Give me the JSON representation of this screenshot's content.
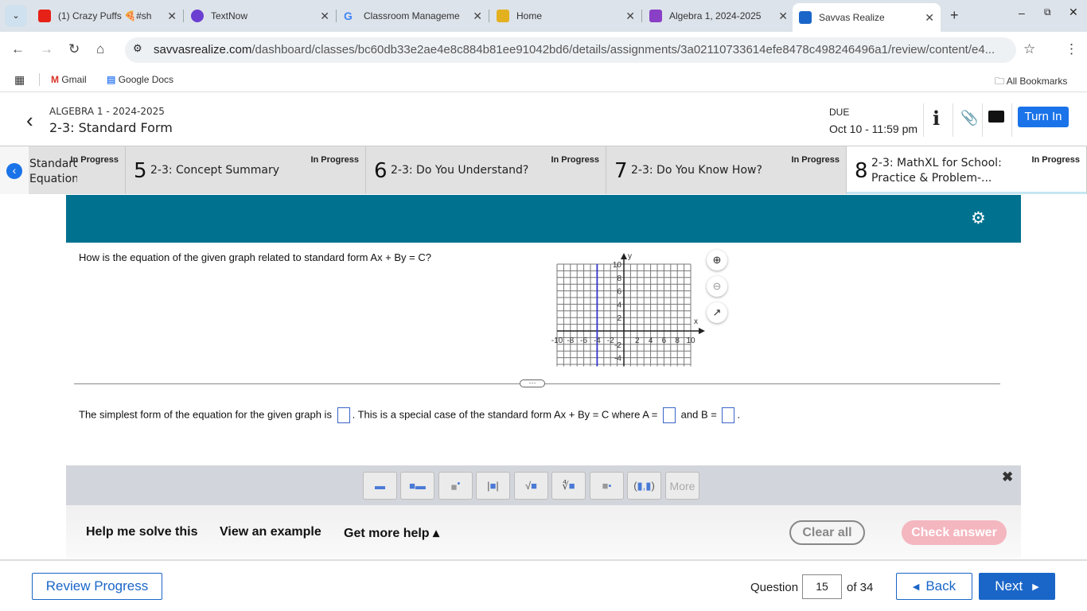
{
  "browser": {
    "tabs": [
      {
        "title": "(1) Crazy Puffs 🍕#sh",
        "icon": "youtube-icon",
        "color": "#e62117"
      },
      {
        "title": "TextNow",
        "icon": "textnow-icon",
        "color": "#6b3fd1"
      },
      {
        "title": "Classroom Manageme",
        "icon": "google-icon",
        "color": "#4285f4"
      },
      {
        "title": "Home",
        "icon": "classroom-icon",
        "color": "#e3b020"
      },
      {
        "title": "Algebra 1, 2024-2025",
        "icon": "classroom-icon",
        "color": "#8a3fc7"
      },
      {
        "title": "Savvas Realize",
        "icon": "savvas-icon",
        "color": "#1a66c8",
        "active": true
      }
    ],
    "url_domain": "savvasrealize.com",
    "url_path": "/dashboard/classes/bc60db33e2ae4e8c884b81ee91042bd6/details/assignments/3a02110733614efe8478c498246496a1/review/content/e4...",
    "bookmarks": [
      "Gmail",
      "Google Docs"
    ],
    "all_bookmarks": "All Bookmarks"
  },
  "header": {
    "course": "ALGEBRA 1 - 2024-2025",
    "title": "2-3: Standard Form",
    "due_label": "DUE",
    "due": "Oct 10 - 11:59 pm",
    "turn_in": "Turn In"
  },
  "content_tabs": [
    {
      "num": "",
      "title": "Standard Equation...",
      "status": "In Progress"
    },
    {
      "num": "5",
      "title": "2-3: Concept Summary",
      "status": "In Progress"
    },
    {
      "num": "6",
      "title": "2-3: Do You Understand?",
      "status": "In Progress"
    },
    {
      "num": "7",
      "title": "2-3: Do You Know How?",
      "status": "In Progress"
    },
    {
      "num": "8",
      "title": "2-3: MathXL for School: Practice & Problem-...",
      "status": "In Progress"
    }
  ],
  "question": {
    "prompt": "How is the equation of the given graph related to standard form Ax + By = C?",
    "answer_part1": "The simplest form of the equation for the given graph is",
    "answer_part2": ". This is a special case of the standard form Ax + By = C where A =",
    "answer_part3": "and B =",
    "answer_end": "."
  },
  "graph": {
    "xlim": [
      -10,
      10
    ],
    "ylim": [
      -5.3,
      10.5
    ],
    "x_label": "x",
    "y_label": "y",
    "x_ticks": [
      "-10",
      "-8",
      "-6",
      "-4",
      "-2",
      "2",
      "4",
      "6",
      "8",
      "10"
    ],
    "y_ticks": [
      "10",
      "8",
      "6",
      "4",
      "2",
      "-2",
      "-4"
    ],
    "vertical_line_x": -4,
    "line_color": "#3333cc"
  },
  "toolbar": {
    "buttons": [
      "fraction",
      "mixed-number",
      "exponent",
      "absolute-value",
      "square-root",
      "nth-root",
      "subscript",
      "ordered-pair"
    ],
    "more": "More"
  },
  "help": {
    "help_me": "Help me solve this",
    "example": "View an example",
    "more_help": "Get more help ▴",
    "clear": "Clear all",
    "check": "Check answer"
  },
  "footer": {
    "review": "Review Progress",
    "question_label": "Question",
    "question_value": "15",
    "of": "of 34",
    "back": "Back",
    "next": "Next"
  }
}
